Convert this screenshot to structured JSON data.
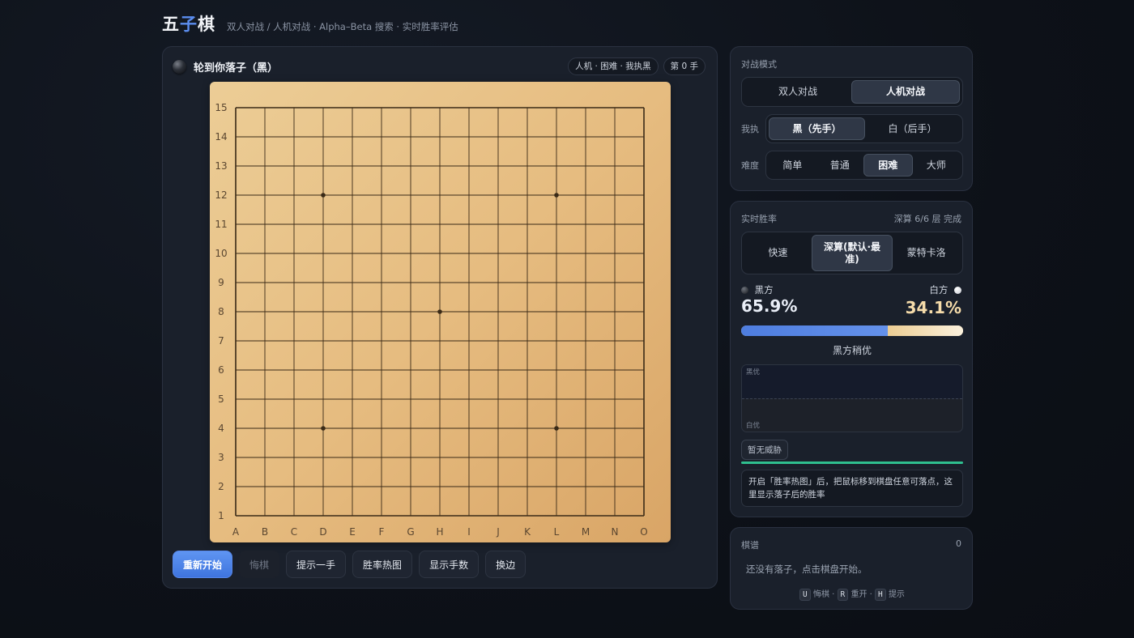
{
  "header": {
    "logo_part1": "五",
    "logo_part2": "子",
    "logo_part3": "棋",
    "subtitle": "双人对战 / 人机对战 · Alpha–Beta 搜索 · 实时胜率评估"
  },
  "status": {
    "turn_text": "轮到你落子（黑）",
    "mode_pill": "人机 · 困难 · 我执黑",
    "move_pill": "第 0 手"
  },
  "board": {
    "size": 15,
    "columns": [
      "A",
      "B",
      "C",
      "D",
      "E",
      "F",
      "G",
      "H",
      "I",
      "J",
      "K",
      "L",
      "M",
      "N",
      "O"
    ],
    "rows": [
      "15",
      "14",
      "13",
      "12",
      "11",
      "10",
      "9",
      "8",
      "7",
      "6",
      "5",
      "4",
      "3",
      "2",
      "1"
    ],
    "star_points": [
      [
        "D",
        "12"
      ],
      [
        "L",
        "12"
      ],
      [
        "H",
        "8"
      ],
      [
        "D",
        "4"
      ],
      [
        "L",
        "4"
      ]
    ],
    "line_color": "#3a2a17",
    "label_color": "#5a4630"
  },
  "controls": {
    "restart": "重新开始",
    "undo": "悔棋",
    "hint": "提示一手",
    "heatmap": "胜率热图",
    "show_moves": "显示手数",
    "swap": "换边"
  },
  "mode": {
    "title": "对战模式",
    "options": [
      "双人对战",
      "人机对战"
    ],
    "selected": "人机对战",
    "side_label": "我执",
    "side_options": [
      "黑（先手）",
      "白（后手）"
    ],
    "side_selected": "黑（先手）",
    "difficulty_label": "难度",
    "difficulty_options": [
      "简单",
      "普通",
      "困难",
      "大师"
    ],
    "difficulty_selected": "困难"
  },
  "winrate": {
    "title": "实时胜率",
    "depth_status": "深算 6/6 层 完成",
    "algo_options": [
      "快速",
      "深算(默认·最准)",
      "蒙特卡洛"
    ],
    "algo_selected": "深算(默认·最准)",
    "black_label": "黑方",
    "white_label": "白方",
    "black_pct": "65.9%",
    "white_pct": "34.1%",
    "black_fraction": 0.659,
    "verdict": "黑方稍优",
    "graph_top_label": "黑优",
    "graph_bottom_label": "白优",
    "threat_badge": "暂无威胁",
    "hint_text": "开启「胜率热图」后，把鼠标移到棋盘任意可落点，这里显示落子后的胜率",
    "colors": {
      "black_bar": "#4f7fe0",
      "white_bar": "#f3d9a4",
      "progress": "#2fbf8f"
    }
  },
  "record": {
    "title": "棋谱",
    "count": "0",
    "empty_text": "还没有落子，点击棋盘开始。",
    "shortcuts": [
      {
        "key": "U",
        "label": "悔棋"
      },
      {
        "key": "R",
        "label": "重开"
      },
      {
        "key": "H",
        "label": "提示"
      }
    ],
    "separator": "·"
  }
}
